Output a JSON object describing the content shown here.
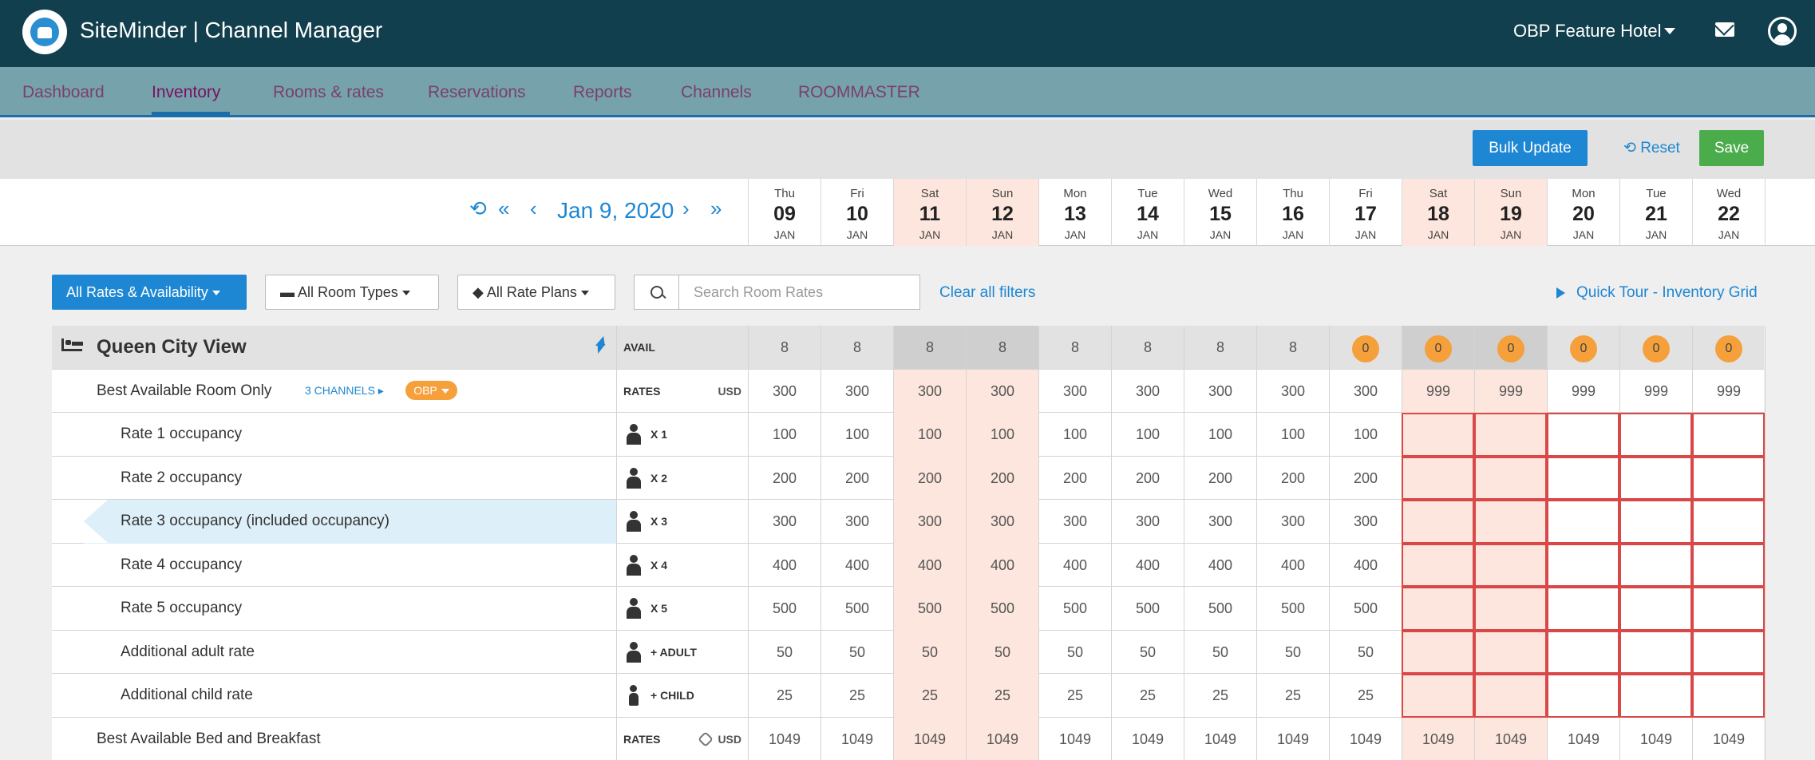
{
  "app": {
    "title": "SiteMinder | Channel Manager",
    "hotel": "OBP Feature Hotel"
  },
  "nav": {
    "items": [
      "Dashboard",
      "Inventory",
      "Rooms & rates",
      "Reservations",
      "Reports",
      "Channels",
      "ROOMMASTER"
    ],
    "active": "Inventory"
  },
  "actions": {
    "bulk_update": "Bulk Update",
    "reset": "Reset",
    "save": "Save"
  },
  "date_nav": {
    "current_date": "Jan 9, 2020"
  },
  "dates": [
    {
      "dow": "Thu",
      "day": "09",
      "mon": "JAN",
      "weekend": false
    },
    {
      "dow": "Fri",
      "day": "10",
      "mon": "JAN",
      "weekend": false
    },
    {
      "dow": "Sat",
      "day": "11",
      "mon": "JAN",
      "weekend": true
    },
    {
      "dow": "Sun",
      "day": "12",
      "mon": "JAN",
      "weekend": true
    },
    {
      "dow": "Mon",
      "day": "13",
      "mon": "JAN",
      "weekend": false
    },
    {
      "dow": "Tue",
      "day": "14",
      "mon": "JAN",
      "weekend": false
    },
    {
      "dow": "Wed",
      "day": "15",
      "mon": "JAN",
      "weekend": false
    },
    {
      "dow": "Thu",
      "day": "16",
      "mon": "JAN",
      "weekend": false
    },
    {
      "dow": "Fri",
      "day": "17",
      "mon": "JAN",
      "weekend": false
    },
    {
      "dow": "Sat",
      "day": "18",
      "mon": "JAN",
      "weekend": true
    },
    {
      "dow": "Sun",
      "day": "19",
      "mon": "JAN",
      "weekend": true
    },
    {
      "dow": "Mon",
      "day": "20",
      "mon": "JAN",
      "weekend": false
    },
    {
      "dow": "Tue",
      "day": "21",
      "mon": "JAN",
      "weekend": false
    },
    {
      "dow": "Wed",
      "day": "22",
      "mon": "JAN",
      "weekend": false
    }
  ],
  "filters": {
    "rates": "All Rates & Availability",
    "room_types": "All Room Types",
    "rate_plans": "All Rate Plans",
    "search_placeholder": "Search Room Rates",
    "clear": "Clear all filters",
    "tour": "Quick Tour - Inventory Grid"
  },
  "room": {
    "name": "Queen City View",
    "avail_label": "AVAIL",
    "avail": [
      "8",
      "8",
      "8",
      "8",
      "8",
      "8",
      "8",
      "8",
      "0",
      "0",
      "0",
      "0",
      "0",
      "0"
    ]
  },
  "rate_plans": [
    {
      "name": "Best Available Room Only",
      "channels": "3 CHANNELS",
      "badge": "OBP",
      "rates_label": "RATES",
      "currency": "USD",
      "values": [
        "300",
        "300",
        "300",
        "300",
        "300",
        "300",
        "300",
        "300",
        "300",
        "999",
        "999",
        "999",
        "999",
        "999"
      ]
    },
    {
      "name": "Best Available Bed and Breakfast",
      "rates_label": "RATES",
      "currency": "USD",
      "values": [
        "1049",
        "1049",
        "1049",
        "1049",
        "1049",
        "1049",
        "1049",
        "1049",
        "1049",
        "1049",
        "1049",
        "1049",
        "1049",
        "1049"
      ]
    }
  ],
  "occupancy_rows": [
    {
      "name": "Rate 1 occupancy",
      "tag": "X 1",
      "icon": "person",
      "values": [
        "100",
        "100",
        "100",
        "100",
        "100",
        "100",
        "100",
        "100",
        "100"
      ]
    },
    {
      "name": "Rate 2 occupancy",
      "tag": "X 2",
      "icon": "person",
      "values": [
        "200",
        "200",
        "200",
        "200",
        "200",
        "200",
        "200",
        "200",
        "200"
      ]
    },
    {
      "name": "Rate 3 occupancy (included occupancy)",
      "tag": "X 3",
      "icon": "person",
      "highlight": true,
      "values": [
        "300",
        "300",
        "300",
        "300",
        "300",
        "300",
        "300",
        "300",
        "300"
      ]
    },
    {
      "name": "Rate 4 occupancy",
      "tag": "X 4",
      "icon": "person",
      "values": [
        "400",
        "400",
        "400",
        "400",
        "400",
        "400",
        "400",
        "400",
        "400"
      ]
    },
    {
      "name": "Rate 5 occupancy",
      "tag": "X 5",
      "icon": "person",
      "values": [
        "500",
        "500",
        "500",
        "500",
        "500",
        "500",
        "500",
        "500",
        "500"
      ]
    },
    {
      "name": "Additional adult rate",
      "tag": "+ ADULT",
      "icon": "person",
      "values": [
        "50",
        "50",
        "50",
        "50",
        "50",
        "50",
        "50",
        "50",
        "50"
      ]
    },
    {
      "name": "Additional child rate",
      "tag": "+ CHILD",
      "icon": "child",
      "values": [
        "25",
        "25",
        "25",
        "25",
        "25",
        "25",
        "25",
        "25",
        "25"
      ]
    }
  ],
  "colors": {
    "topbar": "#123f4d",
    "nav": "#76a2ab",
    "accent": "#1e87d3",
    "save": "#4bac4b",
    "weekend": "#fde6dd",
    "badge": "#f5a03a",
    "error_border": "#d94848"
  }
}
